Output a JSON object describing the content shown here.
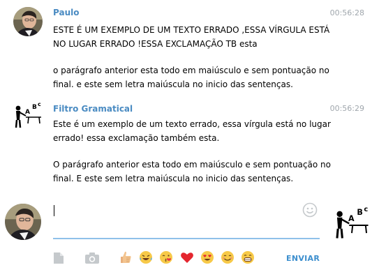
{
  "colors": {
    "sender_name": "#4a8bc2",
    "time": "#a0a7ad",
    "accent": "#3d8fce",
    "input_underline": "#8fc1e9"
  },
  "messages": [
    {
      "sender": "Paulo",
      "time": "00:56:28",
      "avatar_icon": "user-photo-avatar",
      "paragraphs": [
        "ESTE É UM EXEMPLO DE UM TEXTO ERRADO ,ESSA VÍRGULA ESTÁ NO LUGAR ERRADO !ESSA EXCLAMAÇÃO TB esta",
        "o parágrafo anterior esta todo em maiúsculo e sem pontuação no final. e este sem letra maiúscula no inicio das sentenças."
      ]
    },
    {
      "sender": "Filtro Gramatical",
      "time": "00:56:29",
      "avatar_icon": "teacher-blackboard-avatar",
      "paragraphs": [
        "Este é um exemplo de um texto errado, essa vírgula está no lugar errado! essa exclamação também esta.",
        "O parágrafo anterior esta todo em maiúsculo e sem pontuação no final. E este sem letra maiúscula no inicio das sentenças."
      ]
    }
  ],
  "composer": {
    "input_value": "",
    "send_label": "ENVIAR",
    "emoji_icons": [
      "thumbs-up-icon",
      "laughing-tears-icon",
      "kissing-face-icon",
      "red-heart-icon",
      "heart-eyes-icon",
      "smiling-face-icon",
      "grinning-face-icon"
    ]
  }
}
